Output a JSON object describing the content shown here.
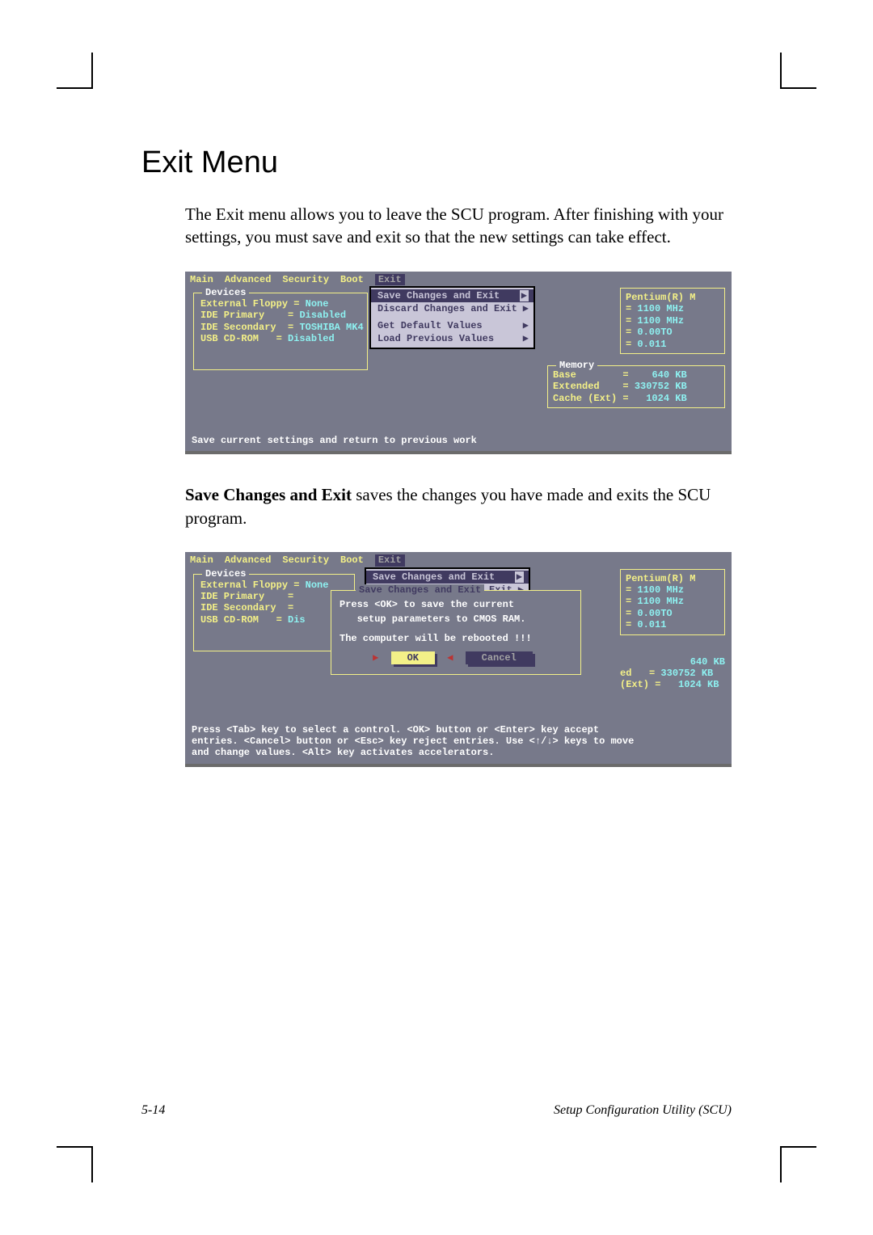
{
  "heading": "Exit Menu",
  "para1": "The Exit menu allows you to leave the SCU program. After finishing with your settings, you must save and exit so that the new settings can take effect.",
  "para2_bold": "Save Changes and Exit",
  "para2_rest": " saves the changes you have made and exits the SCU program.",
  "menubar": [
    "Main",
    "Advanced",
    "Security",
    "Boot",
    "Exit"
  ],
  "devices_legend": "Devices",
  "devices": [
    {
      "label": "External Floppy",
      "value": "None"
    },
    {
      "label": "IDE Primary",
      "value": "Disabled"
    },
    {
      "label": "IDE Secondary",
      "value": "TOSHIBA MK4"
    },
    {
      "label": "USB CD-ROM",
      "value": "Disabled"
    }
  ],
  "exit_menu": {
    "items": [
      {
        "label": "Save Changes and Exit",
        "arrow": "▶",
        "sel": true
      },
      {
        "label": "Discard Changes and Exit",
        "arrow": "▶",
        "sel": false
      }
    ],
    "items2": [
      {
        "label": "Get Default Values",
        "arrow": "▶"
      },
      {
        "label": "Load Previous Values",
        "arrow": "▶"
      }
    ]
  },
  "sysinfo": {
    "cpu": "Pentium(R) M",
    "rows": [
      "1100 MHz",
      "1100 MHz",
      "0.00TO",
      "0.011"
    ]
  },
  "memory": {
    "legend": "Memory",
    "rows": [
      {
        "k": "Base",
        "v": "640 KB"
      },
      {
        "k": "Extended",
        "v": "330752 KB"
      },
      {
        "k": "Cache (Ext)",
        "v": "1024 KB"
      }
    ]
  },
  "help1": "Save current settings and return to previous work",
  "devices_b": [
    {
      "label": "External Floppy",
      "value": "None"
    },
    {
      "label": "IDE Primary",
      "value": ""
    },
    {
      "label": "IDE Secondary",
      "value": ""
    },
    {
      "label": "USB CD-ROM",
      "value": "Dis"
    }
  ],
  "dialog": {
    "title": "Save Changes and Exit",
    "line1": "Press <OK> to save the current",
    "line2": "   setup parameters to CMOS RAM.",
    "line3": "The computer will be rebooted !!!",
    "ok": "OK",
    "cancel": "Cancel"
  },
  "memory_b_extra": {
    "ed": "ed",
    "ext": "(Ext)"
  },
  "help2_l1": "Press <Tab> key to select a control. <OK> button or <Enter> key accept",
  "help2_l2": "entries. <Cancel> button or <Esc> key reject entries. Use <↑/↓> keys to move",
  "help2_l3": "and change values. <Alt> key activates accelerators.",
  "footer_left": "5-14",
  "footer_right": "Setup Configuration Utility (SCU)"
}
